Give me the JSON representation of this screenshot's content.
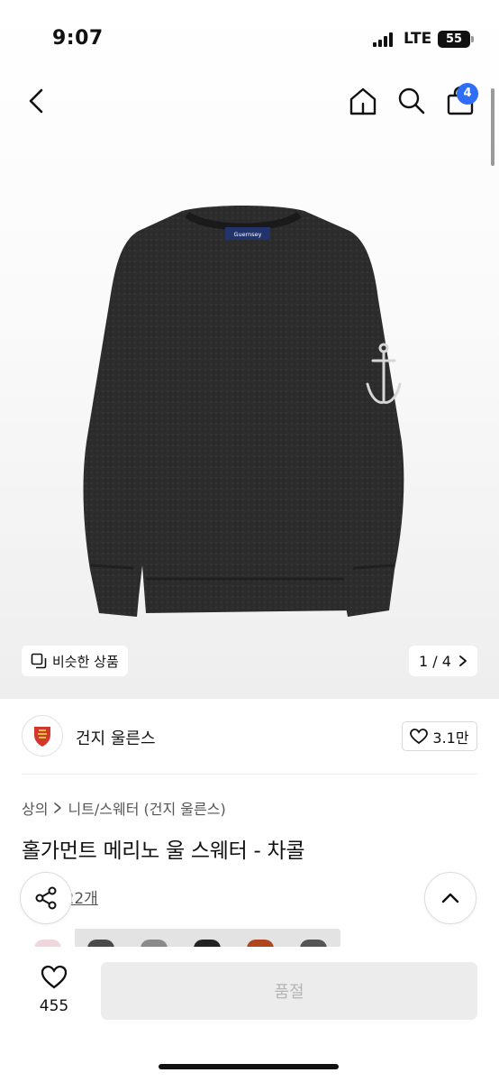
{
  "status_bar": {
    "time": "9:07",
    "network": "LTE",
    "battery": "55"
  },
  "nav": {
    "cart_count": "4"
  },
  "gallery": {
    "similar_label": "비슷한 상품",
    "page_indicator": "1 / 4",
    "tag_text": "Guernsey"
  },
  "brand": {
    "name": "건지 울른스",
    "like_count": "3.1만"
  },
  "breadcrumb": {
    "category": "상의",
    "subcategory": "니트/스웨터 (건지 울른스)"
  },
  "product": {
    "title": "홀가먼트 메리노 울 스웨터 - 차콜",
    "reviews_label": "후기 122개"
  },
  "swatch_colors": [
    "#f1d5dc",
    "#4a4a4a",
    "#8a8a8a",
    "#222222",
    "#b0461f",
    "#555555"
  ],
  "bottom_bar": {
    "wish_count": "455",
    "action_label": "품절"
  },
  "colors": {
    "accent": "#2f6df6",
    "disabled_bg": "#ececec",
    "disabled_text": "#b5b5b5"
  }
}
